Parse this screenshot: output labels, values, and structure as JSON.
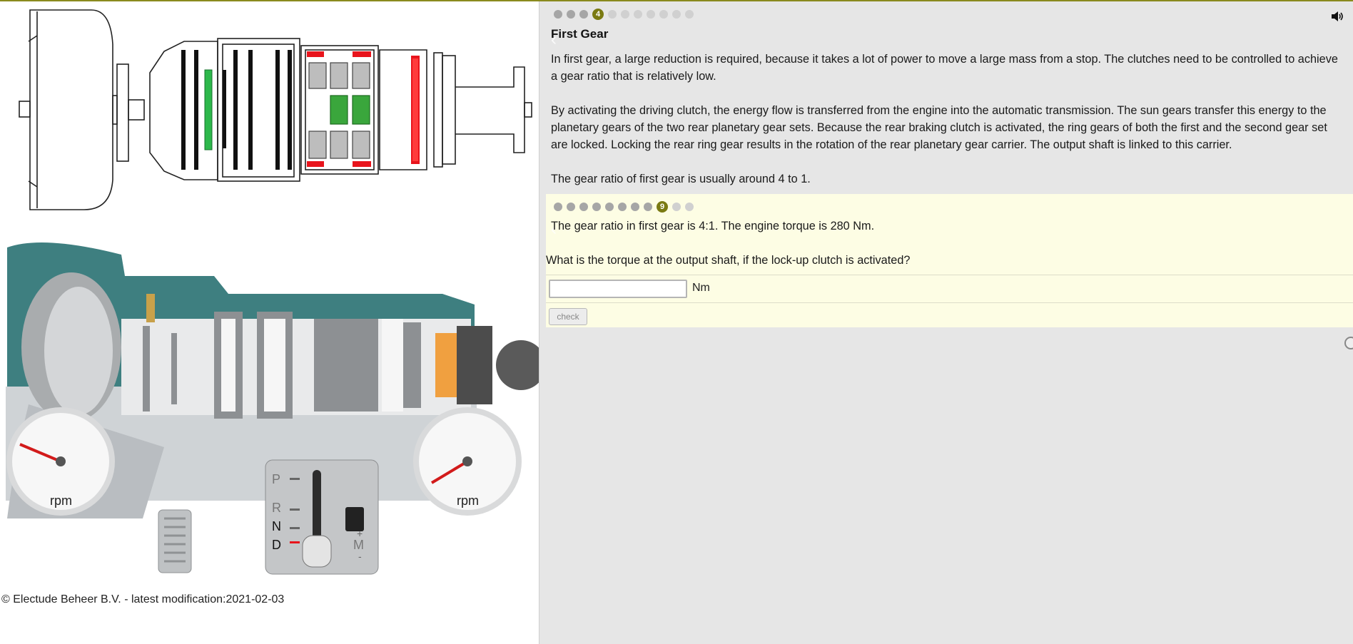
{
  "left": {
    "gauge_unit_left": "rpm",
    "gauge_unit_right": "rpm",
    "gear_selector": {
      "positions": [
        "P",
        "R",
        "N",
        "D"
      ],
      "manual_label": "M",
      "plus": "+",
      "minus": "-"
    },
    "copyright": "© Electude Beheer B.V. - latest modification:2021-02-03",
    "colors": {
      "clutch_active": "#2db84b",
      "brake_active": "#e8141c",
      "housing": "#3e7f80"
    }
  },
  "lesson": {
    "progress": {
      "current_label": "4",
      "before_count": 3,
      "after_count": 7
    },
    "title": "First Gear",
    "paragraphs": [
      "In first gear, a large reduction is required, because it takes a lot of power to move a large mass from a stop. The clutches need to be controlled to achieve a gear ratio that is relatively low.",
      "By activating the driving clutch, the energy flow is transferred from the engine into the automatic transmission. The sun gears transfer this energy to the planetary gears of the two rear planetary gear sets. Because the rear braking clutch is activated, the ring gears of both the first and the second gear set are locked. Locking the rear ring gear results in the rotation of the rear planetary gear carrier. The output shaft is linked to this carrier.",
      "The gear ratio of first gear is usually around 4 to 1."
    ]
  },
  "exercise": {
    "progress": {
      "current_label": "9",
      "before_count": 8,
      "after_count": 2
    },
    "question_line1": "The gear ratio in first gear is 4:1. The engine torque is 280 Nm.",
    "question_line2": "What is the torque at the output shaft, if the lock-up clutch is activated?",
    "answer_value": "",
    "unit": "Nm",
    "check_label": "check"
  },
  "icons": {
    "audio": "speaker-icon"
  },
  "colors": {
    "accent": "#7a7a12",
    "exercise_bg": "#fdfde4",
    "panel_bg": "#e6e6e6"
  }
}
